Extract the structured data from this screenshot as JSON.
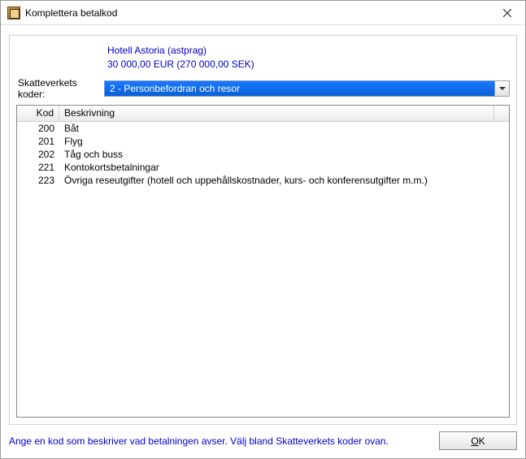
{
  "window": {
    "title": "Komplettera betalkod"
  },
  "info": {
    "hotel_line": "Hotell Astoria  (astprag)",
    "amount_line": "30 000,00 EUR  (270 000,00 SEK)"
  },
  "combo": {
    "label": "Skatteverkets koder:",
    "selected": "2     - Personbefordran och resor"
  },
  "table": {
    "headers": {
      "kod": "Kod",
      "beskrivning": "Beskrivning"
    },
    "rows": [
      {
        "kod": "200",
        "besk": "Båt"
      },
      {
        "kod": "201",
        "besk": "Flyg"
      },
      {
        "kod": "202",
        "besk": "Tåg och buss"
      },
      {
        "kod": "221",
        "besk": "Kontokortsbetalningar"
      },
      {
        "kod": "223",
        "besk": "Övriga reseutgifter (hotell och uppehållskostnader, kurs- och konferensutgifter m.m.)"
      }
    ]
  },
  "hint": "Ange en kod som beskriver vad betalningen avser. Välj bland Skatteverkets koder ovan.",
  "buttons": {
    "ok_prefix": "O",
    "ok_suffix": "K"
  }
}
